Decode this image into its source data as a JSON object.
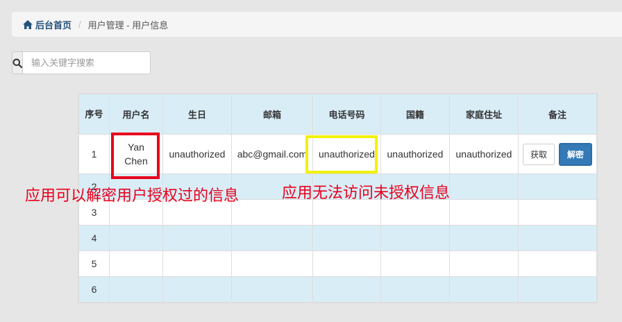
{
  "breadcrumb": {
    "home_label": "后台首页",
    "separator": "/",
    "current": "用户管理 - 用户信息"
  },
  "search": {
    "placeholder": "输入关键字搜索"
  },
  "table": {
    "headers": [
      "序号",
      "用户名",
      "生日",
      "邮箱",
      "电话号码",
      "国籍",
      "家庭住址",
      "备注"
    ],
    "rows": [
      {
        "index": "1",
        "username": "Yan Chen",
        "birthday": "unauthorized",
        "email": "abc@gmail.com",
        "phone": "unauthorized",
        "nationality": "unauthorized",
        "address": "unauthorized"
      },
      {
        "index": "2"
      },
      {
        "index": "3"
      },
      {
        "index": "4"
      },
      {
        "index": "5"
      },
      {
        "index": "6"
      }
    ],
    "get_button": "获取",
    "decrypt_button": "解密"
  },
  "annotations": {
    "red_text": "应用可以解密用户授权过的信息",
    "yellow_text": "应用无法访问未授权信息"
  },
  "colors": {
    "header_bg": "#d9edf7",
    "primary": "#337ab7",
    "annotation_red": "#e8001c",
    "highlight_yellow": "#f1f100"
  }
}
